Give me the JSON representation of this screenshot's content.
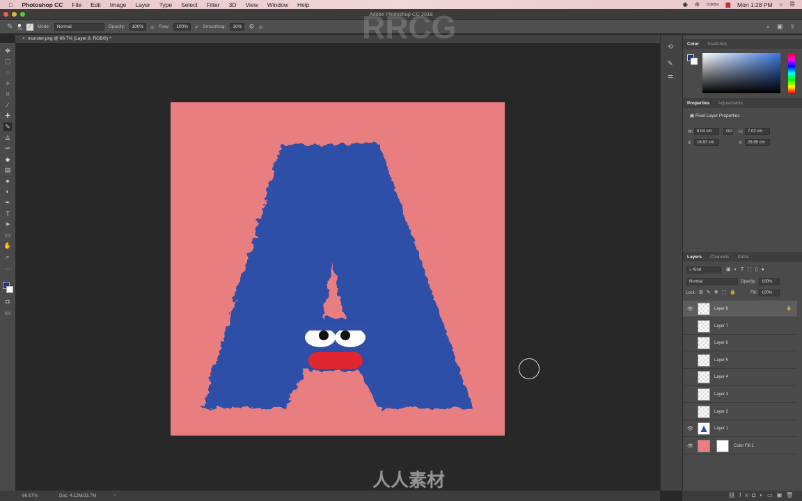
{
  "menubar": {
    "app": "Photoshop CC",
    "items": [
      "File",
      "Edit",
      "Image",
      "Layer",
      "Type",
      "Select",
      "Filter",
      "3D",
      "View",
      "Window",
      "Help"
    ],
    "clock": "Mon 1:28 PM",
    "net": "0.0KB/s"
  },
  "window": {
    "title": "Adobe Photoshop CC 2018"
  },
  "options": {
    "brush_size": "75",
    "mode_label": "Mode:",
    "mode": "Normal",
    "opacity_label": "Opacity:",
    "opacity": "100%",
    "flow_label": "Flow:",
    "flow": "100%",
    "smoothing_label": "Smoothing:",
    "smoothing": "10%"
  },
  "document": {
    "tab": "monster.png @ 66.7% (Layer 8, RGB/8) *"
  },
  "status": {
    "zoom": "66.67%",
    "doc": "Doc: 4.12M/33.7M"
  },
  "colors": {
    "canvas_bg": "#e87e80",
    "fur": "#2f4fa8",
    "mouth": "#e0262f",
    "foreground": "#1f3778"
  },
  "color_panel": {
    "tabs": [
      "Color",
      "Swatches"
    ]
  },
  "properties": {
    "tabs": [
      "Properties",
      "Adjustments"
    ],
    "heading": "Pixel Layer Properties",
    "w_label": "W:",
    "w": "8.04 cm",
    "h_label": "H:",
    "h": "7.02 cm",
    "x_label": "X:",
    "x": "16.97 cm",
    "y_label": "Y:",
    "y": "26.95 cm",
    "link": "GO"
  },
  "layers": {
    "tabs": [
      "Layers",
      "Channels",
      "Paths"
    ],
    "filter": "Kind",
    "blend": "Normal",
    "opacity_label": "Opacity:",
    "opacity": "100%",
    "lock_label": "Lock:",
    "fill_label": "Fill:",
    "fill": "100%",
    "items": [
      {
        "name": "Layer 8",
        "visible": true,
        "selected": true
      },
      {
        "name": "Layer 7",
        "visible": false
      },
      {
        "name": "Layer 6",
        "visible": false
      },
      {
        "name": "Layer 5",
        "visible": false
      },
      {
        "name": "Layer 4",
        "visible": false
      },
      {
        "name": "Layer 3",
        "visible": false
      },
      {
        "name": "Layer 2",
        "visible": false
      },
      {
        "name": "Layer 1",
        "visible": true
      },
      {
        "name": "Color Fill 1",
        "visible": true
      }
    ]
  },
  "watermark": {
    "text": "RRCG",
    "cn": "人人素材"
  }
}
